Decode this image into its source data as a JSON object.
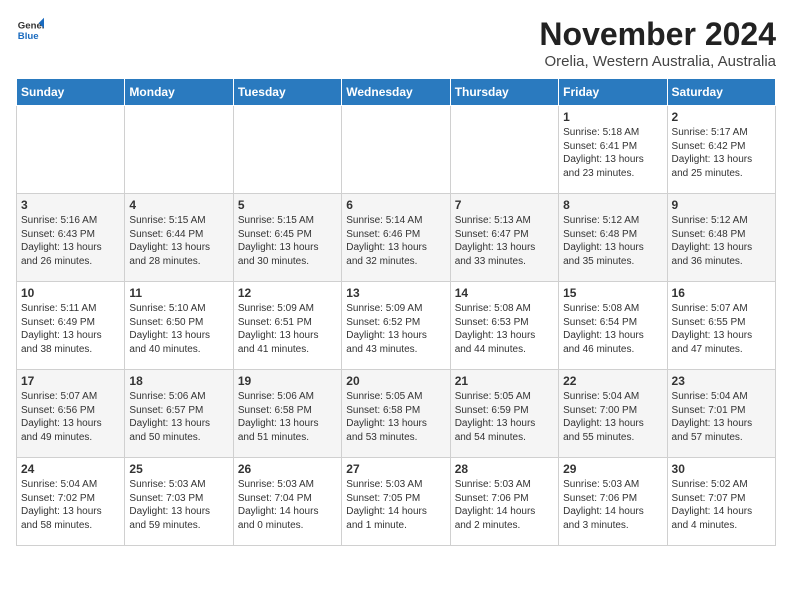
{
  "logo": {
    "general": "General",
    "blue": "Blue"
  },
  "title": "November 2024",
  "location": "Orelia, Western Australia, Australia",
  "weekdays": [
    "Sunday",
    "Monday",
    "Tuesday",
    "Wednesday",
    "Thursday",
    "Friday",
    "Saturday"
  ],
  "weeks": [
    [
      {
        "day": "",
        "info": ""
      },
      {
        "day": "",
        "info": ""
      },
      {
        "day": "",
        "info": ""
      },
      {
        "day": "",
        "info": ""
      },
      {
        "day": "",
        "info": ""
      },
      {
        "day": "1",
        "info": "Sunrise: 5:18 AM\nSunset: 6:41 PM\nDaylight: 13 hours\nand 23 minutes."
      },
      {
        "day": "2",
        "info": "Sunrise: 5:17 AM\nSunset: 6:42 PM\nDaylight: 13 hours\nand 25 minutes."
      }
    ],
    [
      {
        "day": "3",
        "info": "Sunrise: 5:16 AM\nSunset: 6:43 PM\nDaylight: 13 hours\nand 26 minutes."
      },
      {
        "day": "4",
        "info": "Sunrise: 5:15 AM\nSunset: 6:44 PM\nDaylight: 13 hours\nand 28 minutes."
      },
      {
        "day": "5",
        "info": "Sunrise: 5:15 AM\nSunset: 6:45 PM\nDaylight: 13 hours\nand 30 minutes."
      },
      {
        "day": "6",
        "info": "Sunrise: 5:14 AM\nSunset: 6:46 PM\nDaylight: 13 hours\nand 32 minutes."
      },
      {
        "day": "7",
        "info": "Sunrise: 5:13 AM\nSunset: 6:47 PM\nDaylight: 13 hours\nand 33 minutes."
      },
      {
        "day": "8",
        "info": "Sunrise: 5:12 AM\nSunset: 6:48 PM\nDaylight: 13 hours\nand 35 minutes."
      },
      {
        "day": "9",
        "info": "Sunrise: 5:12 AM\nSunset: 6:48 PM\nDaylight: 13 hours\nand 36 minutes."
      }
    ],
    [
      {
        "day": "10",
        "info": "Sunrise: 5:11 AM\nSunset: 6:49 PM\nDaylight: 13 hours\nand 38 minutes."
      },
      {
        "day": "11",
        "info": "Sunrise: 5:10 AM\nSunset: 6:50 PM\nDaylight: 13 hours\nand 40 minutes."
      },
      {
        "day": "12",
        "info": "Sunrise: 5:09 AM\nSunset: 6:51 PM\nDaylight: 13 hours\nand 41 minutes."
      },
      {
        "day": "13",
        "info": "Sunrise: 5:09 AM\nSunset: 6:52 PM\nDaylight: 13 hours\nand 43 minutes."
      },
      {
        "day": "14",
        "info": "Sunrise: 5:08 AM\nSunset: 6:53 PM\nDaylight: 13 hours\nand 44 minutes."
      },
      {
        "day": "15",
        "info": "Sunrise: 5:08 AM\nSunset: 6:54 PM\nDaylight: 13 hours\nand 46 minutes."
      },
      {
        "day": "16",
        "info": "Sunrise: 5:07 AM\nSunset: 6:55 PM\nDaylight: 13 hours\nand 47 minutes."
      }
    ],
    [
      {
        "day": "17",
        "info": "Sunrise: 5:07 AM\nSunset: 6:56 PM\nDaylight: 13 hours\nand 49 minutes."
      },
      {
        "day": "18",
        "info": "Sunrise: 5:06 AM\nSunset: 6:57 PM\nDaylight: 13 hours\nand 50 minutes."
      },
      {
        "day": "19",
        "info": "Sunrise: 5:06 AM\nSunset: 6:58 PM\nDaylight: 13 hours\nand 51 minutes."
      },
      {
        "day": "20",
        "info": "Sunrise: 5:05 AM\nSunset: 6:58 PM\nDaylight: 13 hours\nand 53 minutes."
      },
      {
        "day": "21",
        "info": "Sunrise: 5:05 AM\nSunset: 6:59 PM\nDaylight: 13 hours\nand 54 minutes."
      },
      {
        "day": "22",
        "info": "Sunrise: 5:04 AM\nSunset: 7:00 PM\nDaylight: 13 hours\nand 55 minutes."
      },
      {
        "day": "23",
        "info": "Sunrise: 5:04 AM\nSunset: 7:01 PM\nDaylight: 13 hours\nand 57 minutes."
      }
    ],
    [
      {
        "day": "24",
        "info": "Sunrise: 5:04 AM\nSunset: 7:02 PM\nDaylight: 13 hours\nand 58 minutes."
      },
      {
        "day": "25",
        "info": "Sunrise: 5:03 AM\nSunset: 7:03 PM\nDaylight: 13 hours\nand 59 minutes."
      },
      {
        "day": "26",
        "info": "Sunrise: 5:03 AM\nSunset: 7:04 PM\nDaylight: 14 hours\nand 0 minutes."
      },
      {
        "day": "27",
        "info": "Sunrise: 5:03 AM\nSunset: 7:05 PM\nDaylight: 14 hours\nand 1 minute."
      },
      {
        "day": "28",
        "info": "Sunrise: 5:03 AM\nSunset: 7:06 PM\nDaylight: 14 hours\nand 2 minutes."
      },
      {
        "day": "29",
        "info": "Sunrise: 5:03 AM\nSunset: 7:06 PM\nDaylight: 14 hours\nand 3 minutes."
      },
      {
        "day": "30",
        "info": "Sunrise: 5:02 AM\nSunset: 7:07 PM\nDaylight: 14 hours\nand 4 minutes."
      }
    ]
  ]
}
